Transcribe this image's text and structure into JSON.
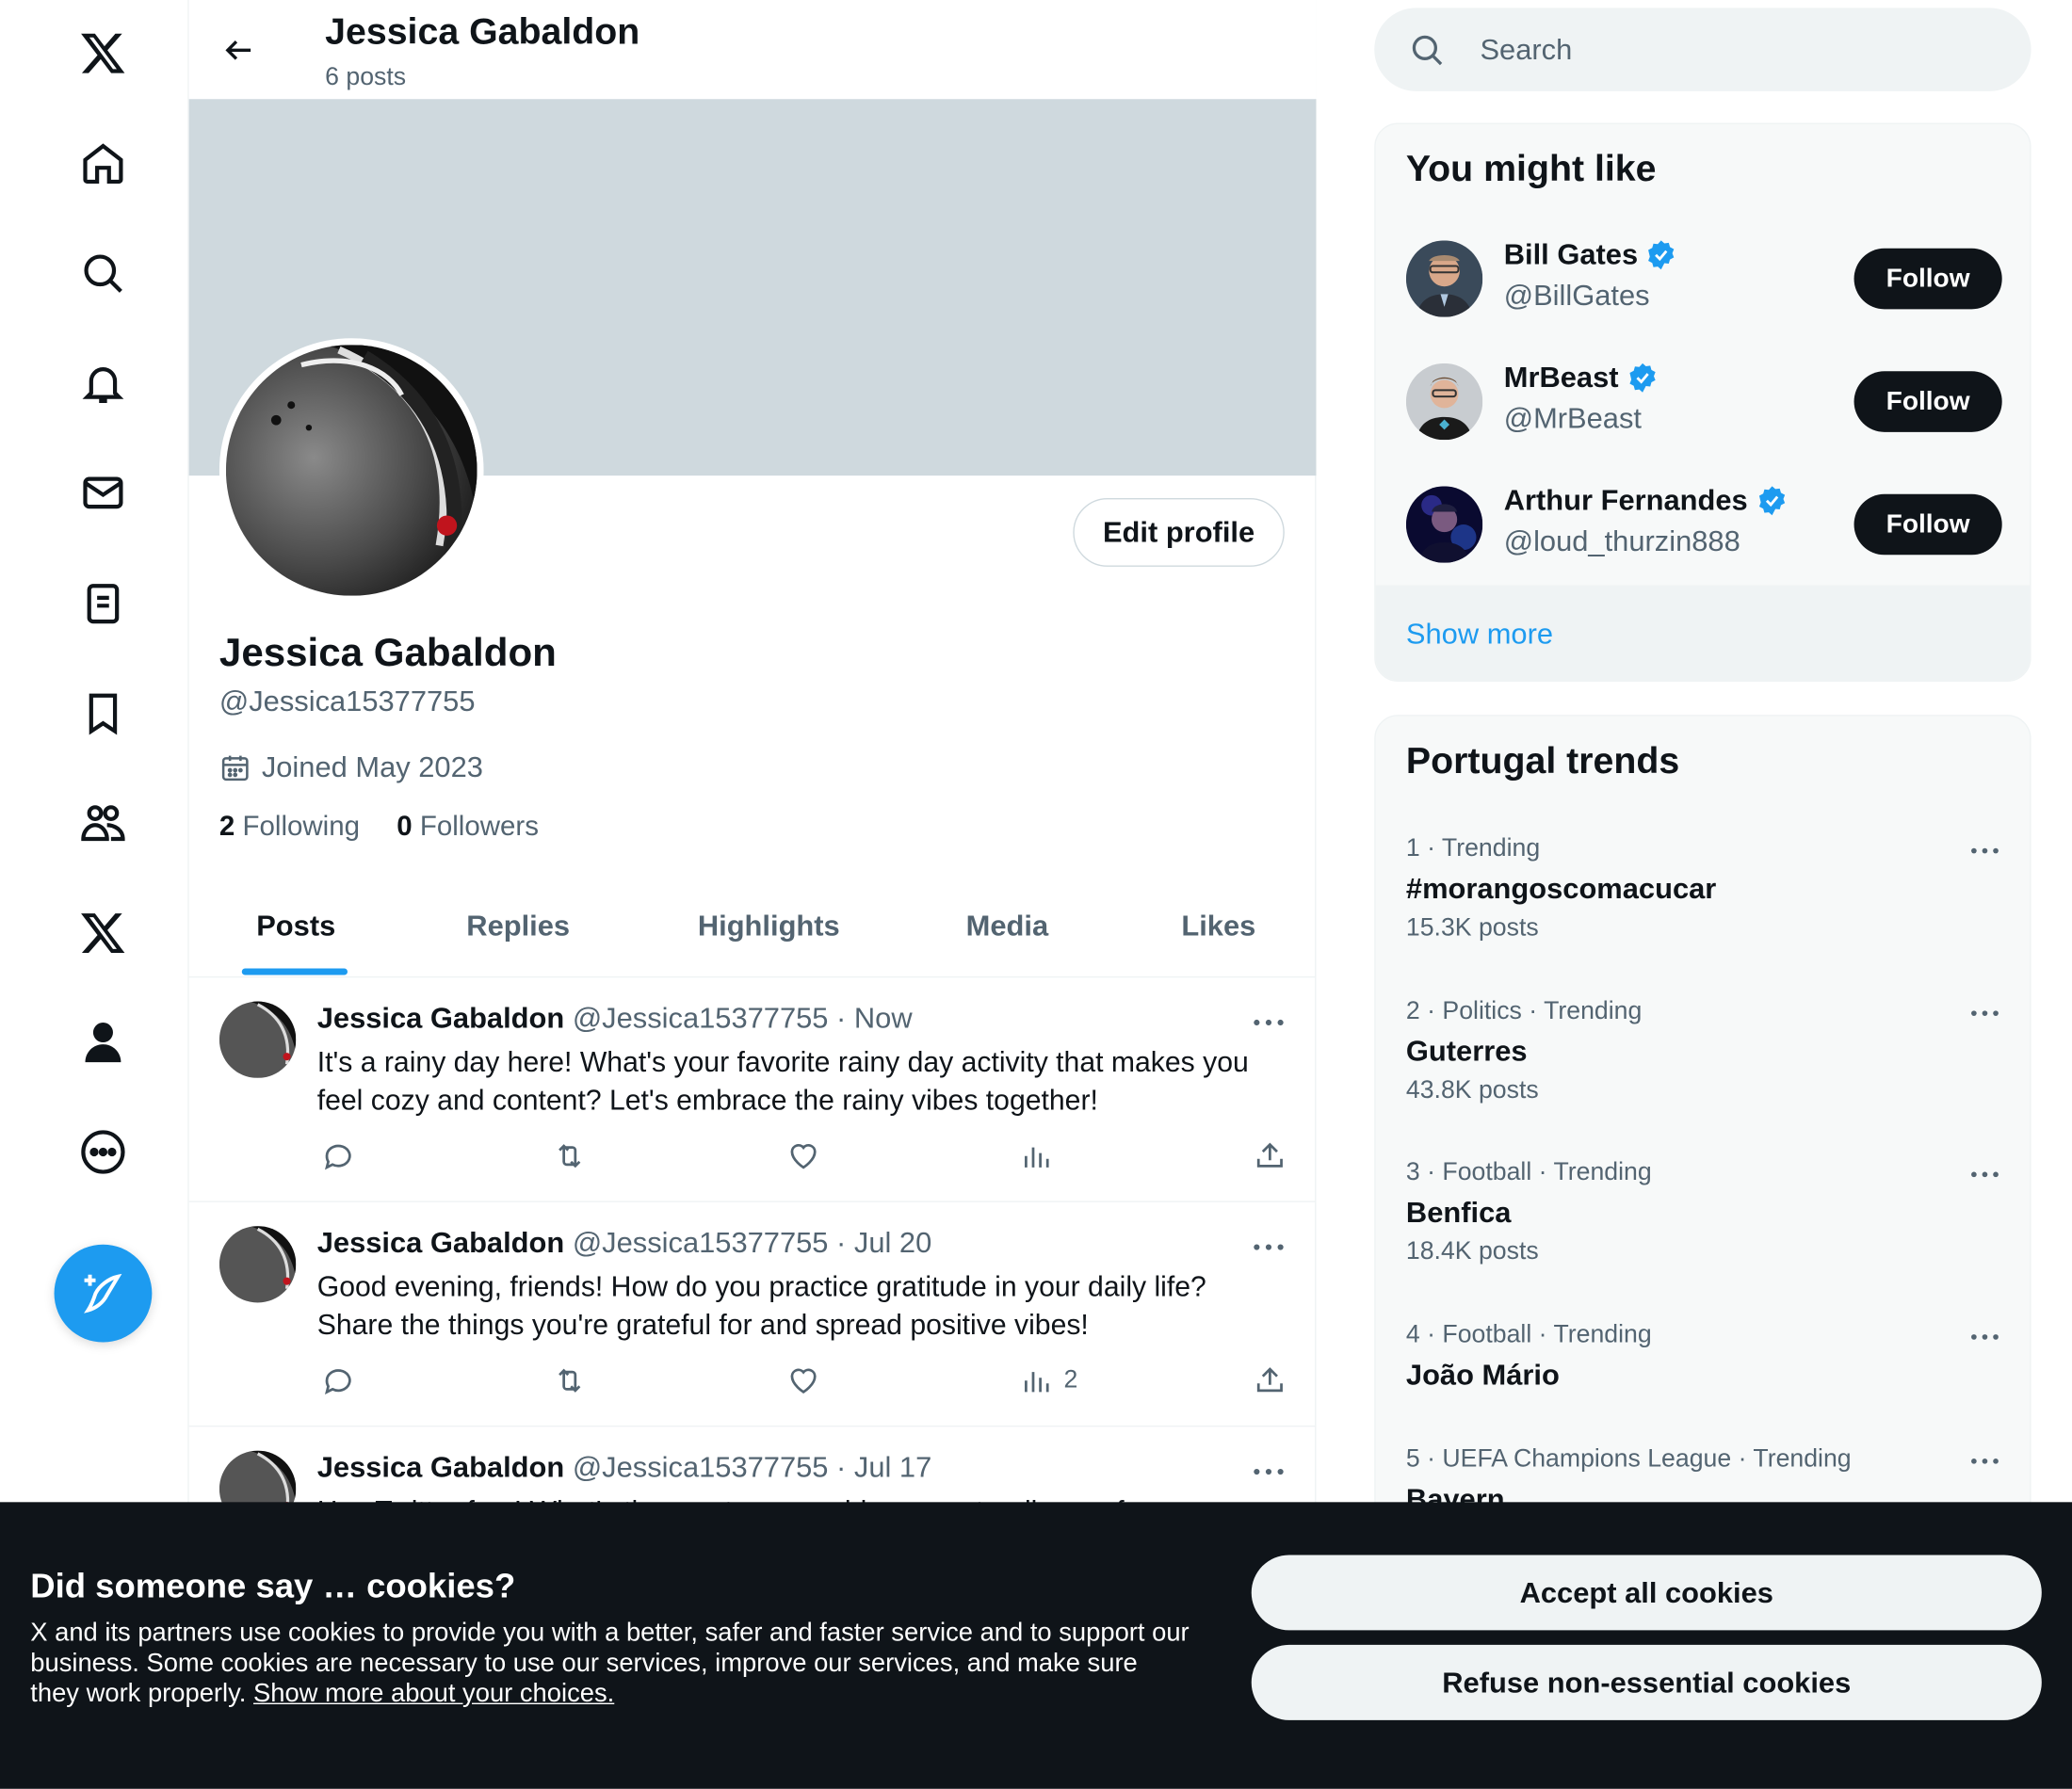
{
  "header": {
    "title": "Jessica Gabaldon",
    "subtitle": "6 posts"
  },
  "profile": {
    "name": "Jessica Gabaldon",
    "handle": "@Jessica15377755",
    "joined": "Joined May 2023",
    "following_count": "2",
    "following_label": "Following",
    "followers_count": "0",
    "followers_label": "Followers",
    "edit_label": "Edit profile"
  },
  "nav": {
    "icons": [
      "x-logo-icon",
      "home-icon",
      "explore-icon",
      "notifications-icon",
      "messages-icon",
      "lists-icon",
      "bookmarks-icon",
      "communities-icon",
      "premium-icon",
      "profile-icon",
      "more-icon"
    ],
    "compose_icon": "compose-icon"
  },
  "tabs": [
    "Posts",
    "Replies",
    "Highlights",
    "Media",
    "Likes"
  ],
  "posts": [
    {
      "name": "Jessica Gabaldon",
      "meta": "@Jessica15377755 · Now",
      "text": "It's a rainy day here! What's your favorite rainy day activity that makes you feel cozy and content? Let's embrace the rainy vibes together!",
      "views": ""
    },
    {
      "name": "Jessica Gabaldon",
      "meta": "@Jessica15377755 · Jul 20",
      "text": "Good evening, friends! How do you practice gratitude in your daily life? Share the things you're grateful for and spread positive vibes!",
      "views": "2"
    },
    {
      "name": "Jessica Gabaldon",
      "meta": "@Jessica15377755 · Jul 17",
      "text": "Hey Twitter fam! What's the most memorable concert or live performance",
      "views": ""
    }
  ],
  "search": {
    "placeholder": "Search"
  },
  "suggestions": {
    "title": "You might like",
    "follow_label": "Follow",
    "show_more": "Show more",
    "items": [
      {
        "name": "Bill Gates",
        "handle": "@BillGates"
      },
      {
        "name": "MrBeast",
        "handle": "@MrBeast"
      },
      {
        "name": "Arthur Fernandes",
        "handle": "@loud_thurzin888"
      }
    ]
  },
  "trends": {
    "title": "Portugal trends",
    "items": [
      {
        "meta": "1 · Trending",
        "name": "#morangoscomacucar",
        "posts": "15.3K posts"
      },
      {
        "meta": "2 · Politics · Trending",
        "name": "Guterres",
        "posts": "43.8K posts"
      },
      {
        "meta": "3 · Football · Trending",
        "name": "Benfica",
        "posts": "18.4K posts"
      },
      {
        "meta": "4 · Football · Trending",
        "name": "João Mário",
        "posts": ""
      },
      {
        "meta": "5 · UEFA Champions League · Trending",
        "name": "Bayern",
        "posts": ""
      }
    ]
  },
  "cookies": {
    "title": "Did someone say … cookies?",
    "text": "X and its partners use cookies to provide you with a better, safer and faster service and to support our business. Some cookies are necessary to use our services, improve our services, and make sure they work properly.",
    "link": "Show more about your choices.",
    "accept": "Accept all cookies",
    "refuse": "Refuse non-essential cookies"
  },
  "colors": {
    "accent": "#1d9bf0",
    "text": "#0f1419",
    "muted": "#536471",
    "banner": "#cfd9de",
    "dark": "#0f1419"
  }
}
